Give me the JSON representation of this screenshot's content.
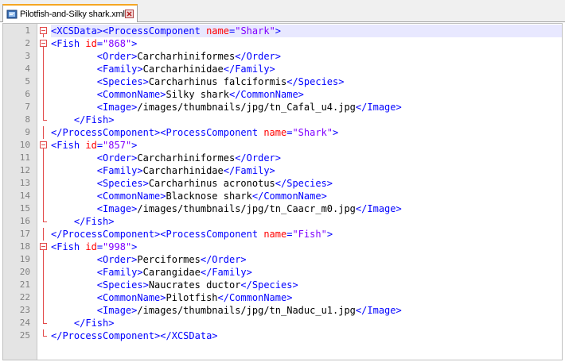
{
  "tab": {
    "title": "Pilotfish-and-Silky shark.xml",
    "icon": "file-icon",
    "close_icon": "close-icon"
  },
  "colors": {
    "tag": "#0000ff",
    "attribute": "#ff0000",
    "value": "#8000ff",
    "text": "#000000",
    "fold_marker": "#e24a4a",
    "current_line": "#e8e8ff"
  },
  "editor": {
    "current_line": 1,
    "lines": [
      {
        "num": "1",
        "fold": "open",
        "indent": 0,
        "tokens": [
          [
            "tag",
            "<XCSData><ProcessComponent "
          ],
          [
            "attr",
            "name"
          ],
          [
            "tag",
            "="
          ],
          [
            "val",
            "\"Shark\""
          ],
          [
            "tag",
            ">"
          ]
        ]
      },
      {
        "num": "2",
        "fold": "open",
        "indent": 0,
        "tokens": [
          [
            "tag",
            "<Fish "
          ],
          [
            "attr",
            "id"
          ],
          [
            "tag",
            "="
          ],
          [
            "val",
            "\"868\""
          ],
          [
            "tag",
            ">"
          ]
        ]
      },
      {
        "num": "3",
        "fold": "line",
        "indent": 8,
        "tokens": [
          [
            "tag",
            "<Order>"
          ],
          [
            "text",
            "Carcharhiniformes"
          ],
          [
            "tag",
            "</Order>"
          ]
        ]
      },
      {
        "num": "4",
        "fold": "line",
        "indent": 8,
        "tokens": [
          [
            "tag",
            "<Family>"
          ],
          [
            "text",
            "Carcharhinidae"
          ],
          [
            "tag",
            "</Family>"
          ]
        ]
      },
      {
        "num": "5",
        "fold": "line",
        "indent": 8,
        "tokens": [
          [
            "tag",
            "<Species>"
          ],
          [
            "text",
            "Carcharhinus falciformis"
          ],
          [
            "tag",
            "</Species>"
          ]
        ]
      },
      {
        "num": "6",
        "fold": "line",
        "indent": 8,
        "tokens": [
          [
            "tag",
            "<CommonName>"
          ],
          [
            "text",
            "Silky shark"
          ],
          [
            "tag",
            "</CommonName>"
          ]
        ]
      },
      {
        "num": "7",
        "fold": "line",
        "indent": 8,
        "tokens": [
          [
            "tag",
            "<Image>"
          ],
          [
            "text",
            "/images/thumbnails/jpg/tn_Cafal_u4.jpg"
          ],
          [
            "tag",
            "</Image>"
          ]
        ]
      },
      {
        "num": "8",
        "fold": "end",
        "indent": 4,
        "tokens": [
          [
            "tag",
            "</Fish>"
          ]
        ]
      },
      {
        "num": "9",
        "fold": "line",
        "indent": 0,
        "tokens": [
          [
            "tag",
            "</ProcessComponent><ProcessComponent "
          ],
          [
            "attr",
            "name"
          ],
          [
            "tag",
            "="
          ],
          [
            "val",
            "\"Shark\""
          ],
          [
            "tag",
            ">"
          ]
        ]
      },
      {
        "num": "10",
        "fold": "open",
        "indent": 0,
        "tokens": [
          [
            "tag",
            "<Fish "
          ],
          [
            "attr",
            "id"
          ],
          [
            "tag",
            "="
          ],
          [
            "val",
            "\"857\""
          ],
          [
            "tag",
            ">"
          ]
        ]
      },
      {
        "num": "11",
        "fold": "line",
        "indent": 8,
        "tokens": [
          [
            "tag",
            "<Order>"
          ],
          [
            "text",
            "Carcharhiniformes"
          ],
          [
            "tag",
            "</Order>"
          ]
        ]
      },
      {
        "num": "12",
        "fold": "line",
        "indent": 8,
        "tokens": [
          [
            "tag",
            "<Family>"
          ],
          [
            "text",
            "Carcharhinidae"
          ],
          [
            "tag",
            "</Family>"
          ]
        ]
      },
      {
        "num": "13",
        "fold": "line",
        "indent": 8,
        "tokens": [
          [
            "tag",
            "<Species>"
          ],
          [
            "text",
            "Carcharhinus acronotus"
          ],
          [
            "tag",
            "</Species>"
          ]
        ]
      },
      {
        "num": "14",
        "fold": "line",
        "indent": 8,
        "tokens": [
          [
            "tag",
            "<CommonName>"
          ],
          [
            "text",
            "Blacknose shark"
          ],
          [
            "tag",
            "</CommonName>"
          ]
        ]
      },
      {
        "num": "15",
        "fold": "line",
        "indent": 8,
        "tokens": [
          [
            "tag",
            "<Image>"
          ],
          [
            "text",
            "/images/thumbnails/jpg/tn_Caacr_m0.jpg"
          ],
          [
            "tag",
            "</Image>"
          ]
        ]
      },
      {
        "num": "16",
        "fold": "end",
        "indent": 4,
        "tokens": [
          [
            "tag",
            "</Fish>"
          ]
        ]
      },
      {
        "num": "17",
        "fold": "line",
        "indent": 0,
        "tokens": [
          [
            "tag",
            "</ProcessComponent><ProcessComponent "
          ],
          [
            "attr",
            "name"
          ],
          [
            "tag",
            "="
          ],
          [
            "val",
            "\"Fish\""
          ],
          [
            "tag",
            ">"
          ]
        ]
      },
      {
        "num": "18",
        "fold": "open",
        "indent": 0,
        "tokens": [
          [
            "tag",
            "<Fish "
          ],
          [
            "attr",
            "id"
          ],
          [
            "tag",
            "="
          ],
          [
            "val",
            "\"998\""
          ],
          [
            "tag",
            ">"
          ]
        ]
      },
      {
        "num": "19",
        "fold": "line",
        "indent": 8,
        "tokens": [
          [
            "tag",
            "<Order>"
          ],
          [
            "text",
            "Perciformes"
          ],
          [
            "tag",
            "</Order>"
          ]
        ]
      },
      {
        "num": "20",
        "fold": "line",
        "indent": 8,
        "tokens": [
          [
            "tag",
            "<Family>"
          ],
          [
            "text",
            "Carangidae"
          ],
          [
            "tag",
            "</Family>"
          ]
        ]
      },
      {
        "num": "21",
        "fold": "line",
        "indent": 8,
        "tokens": [
          [
            "tag",
            "<Species>"
          ],
          [
            "text",
            "Naucrates ductor"
          ],
          [
            "tag",
            "</Species>"
          ]
        ]
      },
      {
        "num": "22",
        "fold": "line",
        "indent": 8,
        "tokens": [
          [
            "tag",
            "<CommonName>"
          ],
          [
            "text",
            "Pilotfish"
          ],
          [
            "tag",
            "</CommonName>"
          ]
        ]
      },
      {
        "num": "23",
        "fold": "line",
        "indent": 8,
        "tokens": [
          [
            "tag",
            "<Image>"
          ],
          [
            "text",
            "/images/thumbnails/jpg/tn_Naduc_u1.jpg"
          ],
          [
            "tag",
            "</Image>"
          ]
        ]
      },
      {
        "num": "24",
        "fold": "end",
        "indent": 4,
        "tokens": [
          [
            "tag",
            "</Fish>"
          ]
        ]
      },
      {
        "num": "25",
        "fold": "end",
        "indent": 0,
        "tokens": [
          [
            "tag",
            "</ProcessComponent></XCSData>"
          ]
        ]
      }
    ]
  }
}
